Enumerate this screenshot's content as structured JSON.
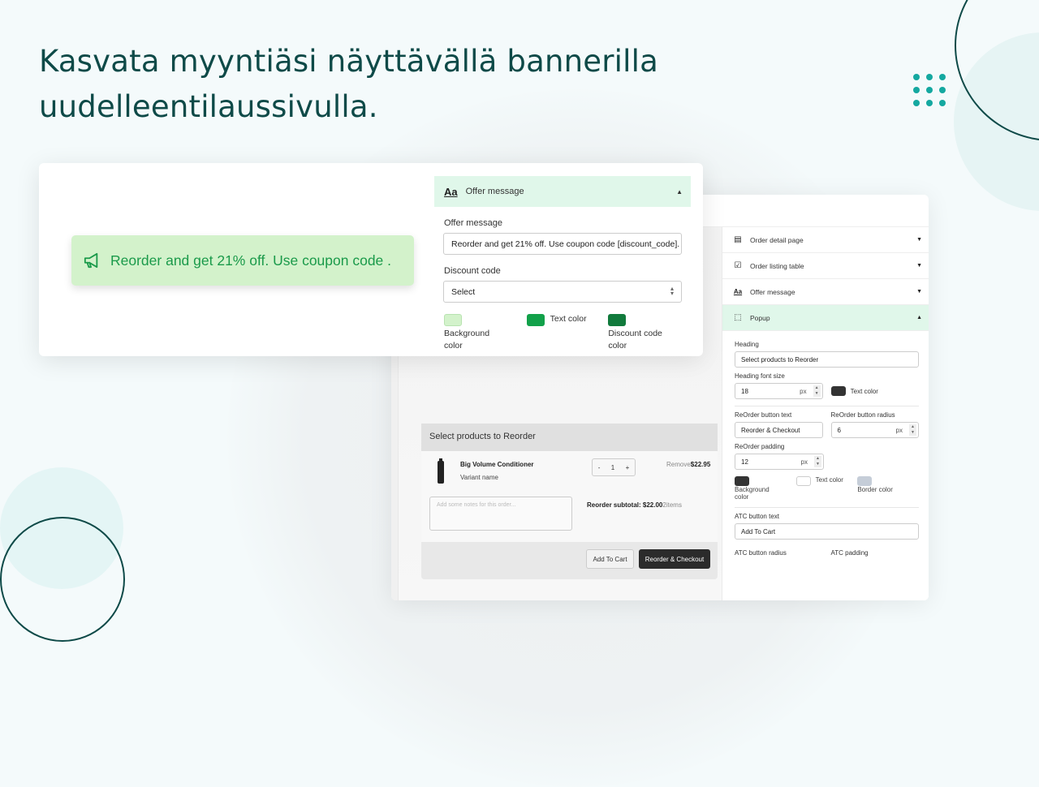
{
  "headline": "Kasvata myyntiäsi näyttävällä bannerilla uudelleentilaussivulla.",
  "banner": {
    "icon": "megaphone-icon",
    "text": "Reorder and get 21% off. Use coupon code .",
    "background_color": "#d3f2cb",
    "text_color": "#1a9a4a"
  },
  "offer_panel": {
    "section_title": "Offer message",
    "offer_message_label": "Offer message",
    "offer_message_value": "Reorder and get 21% off. Use coupon code [discount_code].",
    "discount_code_label": "Discount code",
    "discount_code_value": "Select",
    "colors": [
      {
        "label_line1": "Background",
        "label_line2": "color",
        "value": "#d3f2cb"
      },
      {
        "label_line1": "Text color",
        "label_line2": "",
        "value": "#12a14a"
      },
      {
        "label_line1": "Discount code",
        "label_line2": "color",
        "value": "#117a3c"
      }
    ]
  },
  "popup_preview": {
    "heading": "Select products to Reorder",
    "product_name": "Big Volume Conditioner",
    "variant": "Variant name",
    "qty_minus": "-",
    "qty": "1",
    "qty_plus": "+",
    "remove": "Remove",
    "price": "$22.95",
    "notes_placeholder": "Add some notes for this order...",
    "subtotal_label": "Reorder subtotal: $22.00",
    "items_count": "2items",
    "atc_button": "Add To Cart",
    "reorder_button": "Reorder & Checkout"
  },
  "settings": {
    "accordion": [
      {
        "label": "Order detail page",
        "icon": "page-layout-icon",
        "expanded": false
      },
      {
        "label": "Order listing table",
        "icon": "list-check-icon",
        "expanded": false
      },
      {
        "label": "Offer message",
        "icon": "text-style-icon",
        "expanded": false
      },
      {
        "label": "Popup",
        "icon": "popup-frame-icon",
        "expanded": true
      }
    ],
    "heading_label": "Heading",
    "heading_value": "Select products to Reorder",
    "heading_font_size_label": "Heading font size",
    "heading_font_size_value": "18",
    "unit": "px",
    "heading_text_color_label": "Text color",
    "heading_text_color": "#333333",
    "reorder_text_label": "ReOrder button text",
    "reorder_text_value": "Reorder & Checkout",
    "reorder_radius_label": "ReOrder button radius",
    "reorder_radius_value": "6",
    "reorder_padding_label": "ReOrder padding",
    "reorder_padding_value": "12",
    "reorder_colors": [
      {
        "label_line1": "Background",
        "label_line2": "color",
        "value": "#333333"
      },
      {
        "label_line1": "Text color",
        "label_line2": "",
        "value": "#ffffff"
      },
      {
        "label_line1": "Border color",
        "label_line2": "",
        "value": "#c5cdd8"
      }
    ],
    "atc_text_label": "ATC button text",
    "atc_text_value": "Add To Cart",
    "atc_radius_label": "ATC button radius",
    "atc_padding_label": "ATC padding"
  }
}
